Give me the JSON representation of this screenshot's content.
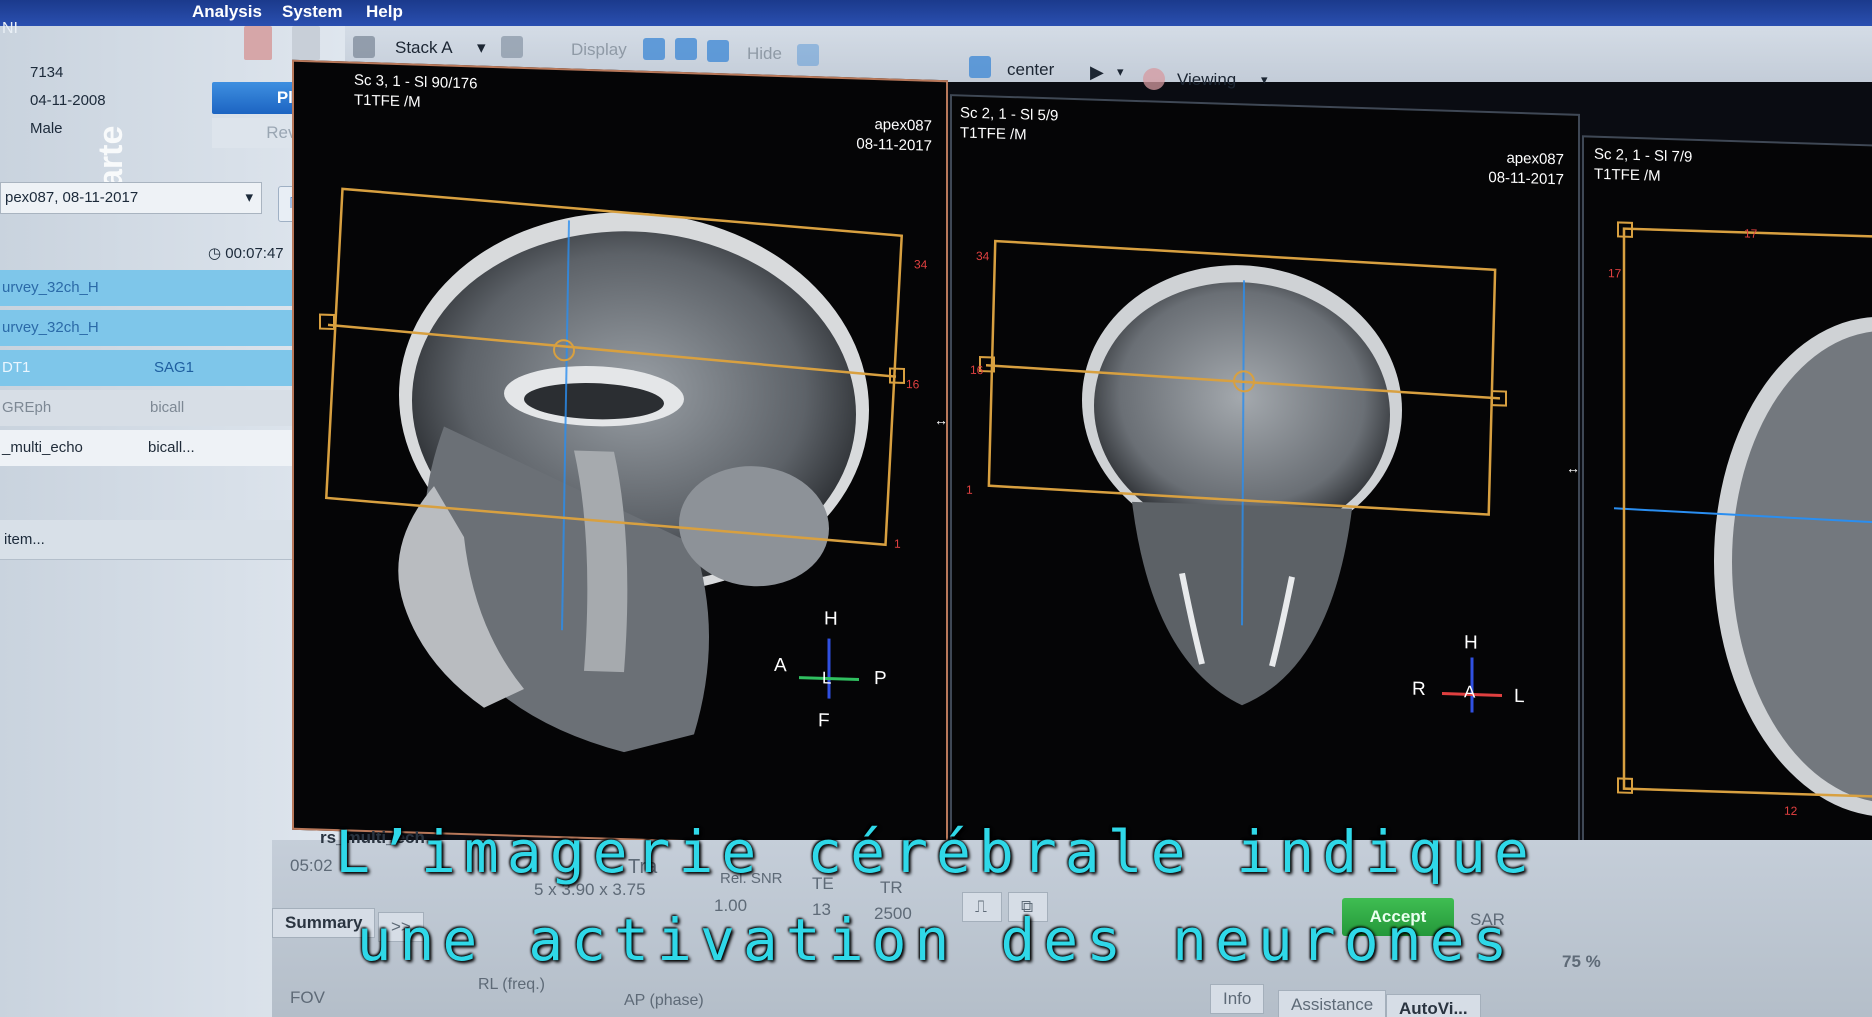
{
  "menubar": {
    "items": [
      "Analysis",
      "System",
      "Help"
    ]
  },
  "patient": {
    "id": "7134",
    "dob": "04-11-2008",
    "sex": "Male",
    "title_fragment": "NI"
  },
  "left": {
    "plan_label": "Plan",
    "review_label": "Review",
    "exam": "pex087, 08-11-2017",
    "timer": "00:07:47",
    "scans": [
      {
        "name": "urvey_32ch_H",
        "detail": ""
      },
      {
        "name": "urvey_32ch_H",
        "detail": ""
      },
      {
        "name": "DT1",
        "detail": "SAG1"
      },
      {
        "name": "GREph",
        "detail": "bicall"
      },
      {
        "name": "_multi_echo",
        "detail": "bicall..."
      }
    ],
    "item_row": "item..."
  },
  "toolbar": {
    "stack": "Stack A",
    "display": "Display",
    "hide": "Hide",
    "center": "center",
    "viewing": "Viewing"
  },
  "viewports": [
    {
      "series": "Sc 3, 1 - Sl 90/176",
      "seq": "T1TFE  /M",
      "exam": "apex087",
      "date": "08-11-2017",
      "orient": {
        "top": "H",
        "left": "A",
        "right": "P",
        "bottom": "F",
        "center": "L"
      },
      "marks": {
        "a": "34",
        "b": "16",
        "c": "1"
      }
    },
    {
      "series": "Sc 2, 1 - Sl 5/9",
      "seq": "T1TFE  /M",
      "exam": "apex087",
      "date": "08-11-2017",
      "orient": {
        "top": "H",
        "left": "R",
        "right": "L",
        "center": "A"
      },
      "marks": {
        "a": "34",
        "b": "16",
        "c": "1"
      }
    },
    {
      "series": "Sc 2, 1 - Sl 7/9",
      "seq": "T1TFE  /M",
      "marks": {
        "a": "17",
        "b": "12"
      }
    }
  ],
  "bottom": {
    "scan_name": "rs_multi_ech",
    "time": "05:02",
    "tra": "Tra",
    "voxel": "5 x 3.90 x 3.75",
    "rel_snr_label": "Rel. SNR",
    "rel_snr": "1.00",
    "te_label": "TE",
    "te": "13",
    "tr_label": "TR",
    "tr": "2500",
    "accept": "Accept",
    "sar": "SAR",
    "pct": "75 %",
    "summary": "Summary",
    "more": ">>",
    "fov": "FOV",
    "rl": "RL (freq.)",
    "ap": "AP (phase)",
    "tabs": [
      "Info",
      "Assistance",
      "AutoVi..."
    ]
  },
  "subtitle": {
    "line1": "L’imagerie cérébrale indique",
    "line2": "une activation des neurones"
  },
  "watermark": "arte",
  "colors": {
    "plan_box": "#d8a040",
    "blue_line": "#2a8ef0",
    "subtitle": "#2fd8e8",
    "accept": "#2ea843"
  }
}
